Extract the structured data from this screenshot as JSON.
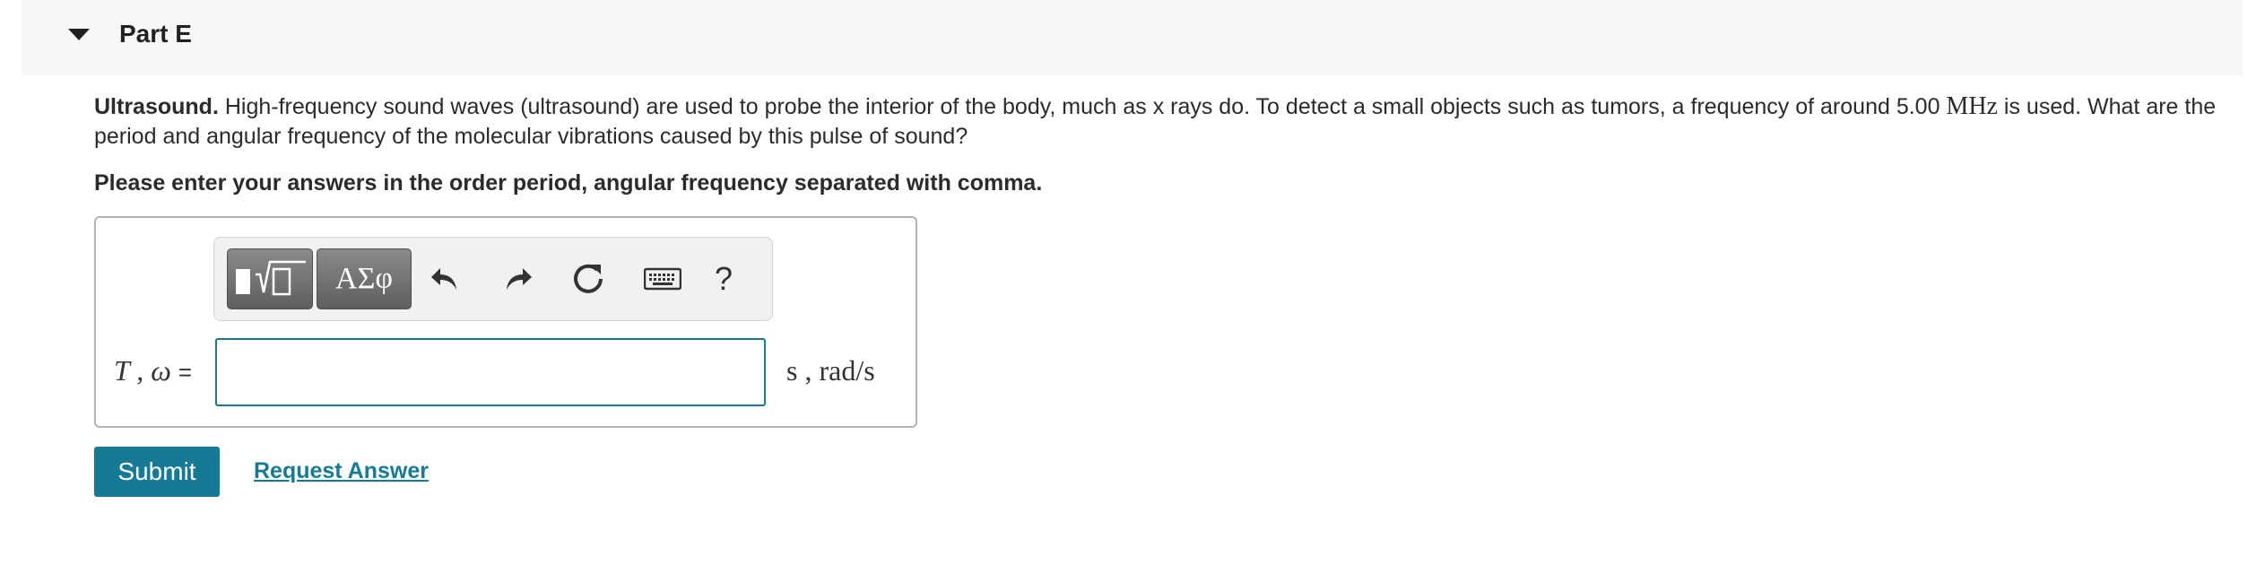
{
  "part": {
    "title": "Part E"
  },
  "question": {
    "bold_lead": "Ultrasound.",
    "text_before_unit": " High-frequency sound waves (ultrasound) are used to probe the interior of the body, much as x rays do. To detect a small objects such as tumors, a frequency of around 5.00 ",
    "unit": "MHz",
    "text_after_unit": " is used. What are the period and angular frequency of the molecular vibrations caused by this pulse of sound?"
  },
  "instruction": "Please enter your answers in the order period, angular frequency separated with comma.",
  "toolbar": {
    "greek_label": "ΑΣφ",
    "help_label": "?",
    "icons": [
      "templates-icon",
      "undo-icon",
      "redo-icon",
      "reset-icon",
      "keyboard-icon",
      "help-icon"
    ]
  },
  "answer": {
    "variable_label": "T , ω",
    "equals": "=",
    "value": "",
    "units": "s , rad/s"
  },
  "actions": {
    "submit_label": "Submit",
    "request_label": "Request Answer"
  },
  "colors": {
    "accent": "#167a94",
    "header_bg": "#f7f7f7",
    "toolbar_button": "#6b6b6b"
  }
}
